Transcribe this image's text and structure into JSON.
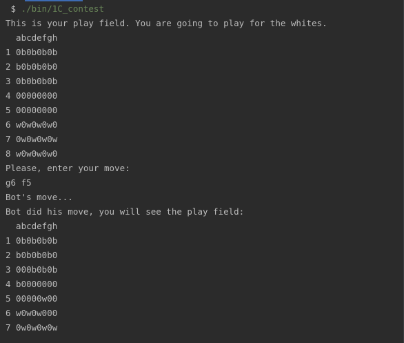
{
  "prompt": {
    "symbol": " $ ",
    "command": "./bin/1C_contest"
  },
  "output_lines": [
    "This is your play field. You are going to play for the whites.",
    "  abcdefgh",
    "1 0b0b0b0b",
    "2 b0b0b0b0",
    "3 0b0b0b0b",
    "4 00000000",
    "5 00000000",
    "6 w0w0w0w0",
    "7 0w0w0w0w",
    "8 w0w0w0w0",
    "Please, enter your move:",
    "g6 f5",
    "Bot's move...",
    "Bot did his move, you will see the play field:",
    "  abcdefgh",
    "1 0b0b0b0b",
    "2 b0b0b0b0",
    "3 000b0b0b",
    "4 b0000000",
    "5 00000w00",
    "6 w0w0w000",
    "7 0w0w0w0w"
  ],
  "colors": {
    "background": "#2b2b2b",
    "text": "#bbbbbb",
    "command": "#6a8759",
    "tab_accent": "#3d6bb3"
  }
}
